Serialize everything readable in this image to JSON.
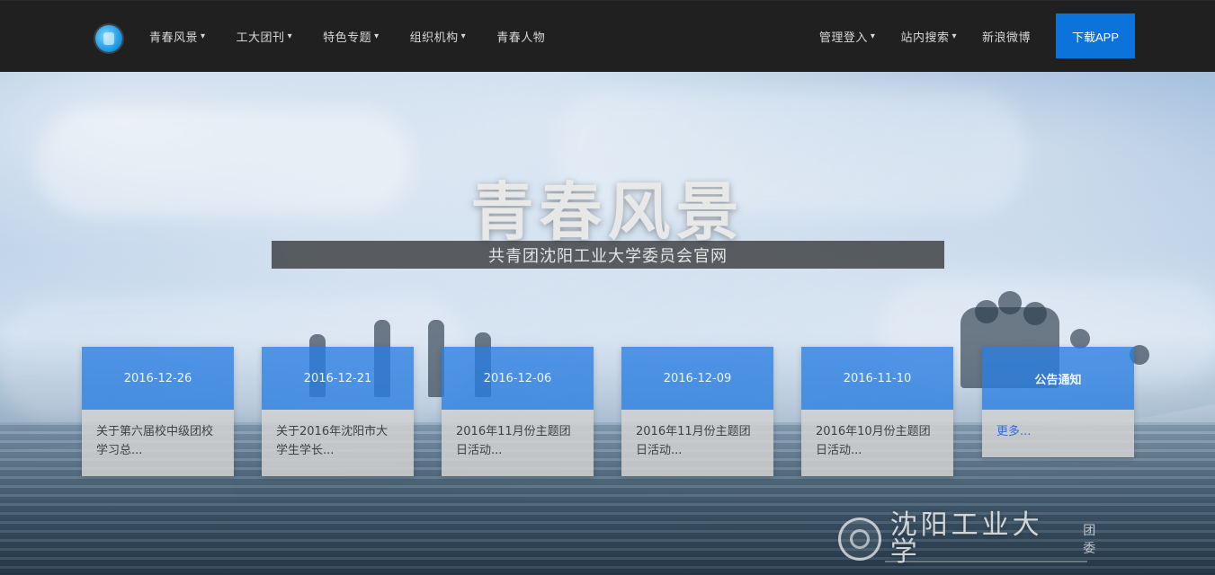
{
  "nav": {
    "left": [
      {
        "label": "青春风景",
        "caret": true
      },
      {
        "label": "工大团刊",
        "caret": true
      },
      {
        "label": "特色专题",
        "caret": true
      },
      {
        "label": "组织机构",
        "caret": true
      },
      {
        "label": "青春人物",
        "caret": false
      }
    ],
    "right": [
      {
        "label": "管理登入",
        "caret": true
      },
      {
        "label": "站内搜索",
        "caret": true
      },
      {
        "label": "新浪微博",
        "caret": false
      }
    ],
    "download_label": "下载APP"
  },
  "hero": {
    "title": "青春风景",
    "subtitle": "共青团沈阳工业大学委员会官网"
  },
  "cards": [
    {
      "date": "2016-12-26",
      "text": "关于第六届校中级团校学习总..."
    },
    {
      "date": "2016-12-21",
      "text": "关于2016年沈阳市大学生学长..."
    },
    {
      "date": "2016-12-06",
      "text": "2016年11月份主题团日活动..."
    },
    {
      "date": "2016-12-09",
      "text": "2016年11月份主题团日活动..."
    },
    {
      "date": "2016-11-10",
      "text": "2016年10月份主题团日活动..."
    }
  ],
  "notice": {
    "title": "公告通知",
    "text": "更多..."
  },
  "brand": {
    "calligraphy": "沈阳工业大学",
    "suffix": "团委"
  },
  "colors": {
    "nav_bg": "#202020",
    "accent_blue": "#0b73d9",
    "card_head": "#297ee2",
    "card_body": "#d2d2d2"
  },
  "icons": {
    "logo": "circle-emblem",
    "caret": "chevron-down"
  }
}
